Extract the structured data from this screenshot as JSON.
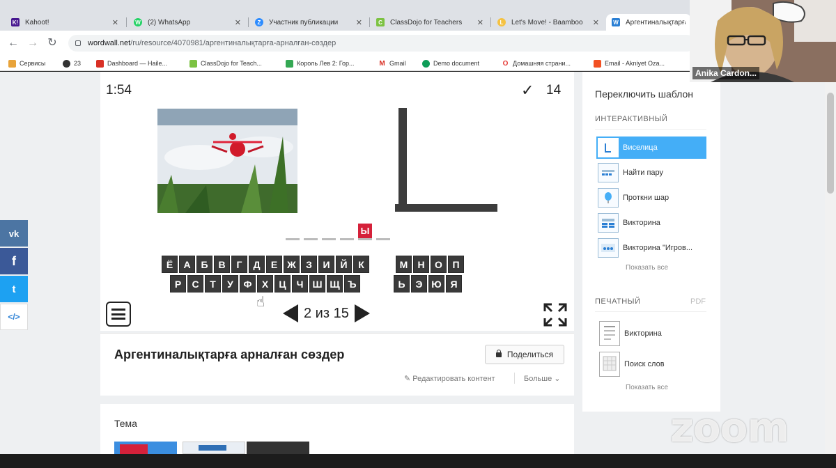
{
  "tabs": [
    {
      "title": "Kahoot!",
      "color": "#46178f",
      "glyph": "K!"
    },
    {
      "title": "(2) WhatsApp",
      "color": "#25d366",
      "glyph": "W"
    },
    {
      "title": "Участник публикации",
      "color": "#2d8cff",
      "glyph": "Z"
    },
    {
      "title": "ClassDojo for Teachers",
      "color": "#7cc242",
      "glyph": "C"
    },
    {
      "title": "Let's Move! - Baamboo",
      "color": "#f5c242",
      "glyph": "L"
    },
    {
      "title": "Аргентиналықтарға",
      "color": "#2a7fd4",
      "glyph": "W"
    }
  ],
  "address": {
    "host": "wordwall.net",
    "path": "/ru/resource/4070981/аргентиналықтарға-арналған-сөздер"
  },
  "bookmarks": [
    "Сервисы",
    "23",
    "Dashboard — Haile...",
    "ClassDojo for Teach...",
    "Король Лев 2: Гор...",
    "Gmail",
    "Demo document",
    "Домашняя страни...",
    "Email - Akniyet Oza..."
  ],
  "game": {
    "timer": "1:54",
    "score": "14",
    "revealed_letter": "Ы",
    "slot_count": 6,
    "revealed_index": 4,
    "keyboard": {
      "row1a": [
        "Ё",
        "А",
        "Б",
        "В",
        "Г",
        "Д",
        "Е",
        "Ж",
        "З",
        "И",
        "Й",
        "К"
      ],
      "row1b": [
        "М",
        "Н",
        "О",
        "П"
      ],
      "row2a": [
        "Р",
        "С",
        "Т",
        "У",
        "Ф",
        "Х",
        "Ц",
        "Ч",
        "Ш",
        "Щ",
        "Ъ"
      ],
      "row2b": [
        "Ь",
        "Э",
        "Ю",
        "Я"
      ]
    },
    "pager": "2 из 15"
  },
  "info": {
    "title": "Аргентиналықтарға арналған сөздер",
    "share": "Поделиться",
    "edit": "Редактировать контент",
    "more": "Больше"
  },
  "theme": {
    "title": "Тема"
  },
  "panel": {
    "title": "Переключить шаблон",
    "interactive_label": "ИНТЕРАКТИВНЫЙ",
    "interactive": [
      "Виселица",
      "Найти пару",
      "Проткни шар",
      "Викторина",
      "Викторина \"Игров..."
    ],
    "show_all": "Показать все",
    "printable_label": "ПЕЧАТНЫЙ",
    "pdf": "PDF",
    "printable": [
      "Викторина",
      "Поиск слов"
    ]
  },
  "social": [
    {
      "name": "vk",
      "glyph": "vk",
      "color": "#4c75a3"
    },
    {
      "name": "facebook",
      "glyph": "f",
      "color": "#3b5998"
    },
    {
      "name": "twitter",
      "glyph": "t",
      "color": "#1da1f2"
    },
    {
      "name": "embed",
      "glyph": "</>",
      "color": "#ffffff"
    }
  ],
  "video": {
    "name": "Anika Cardon..."
  },
  "zoom_logo": "zoom"
}
